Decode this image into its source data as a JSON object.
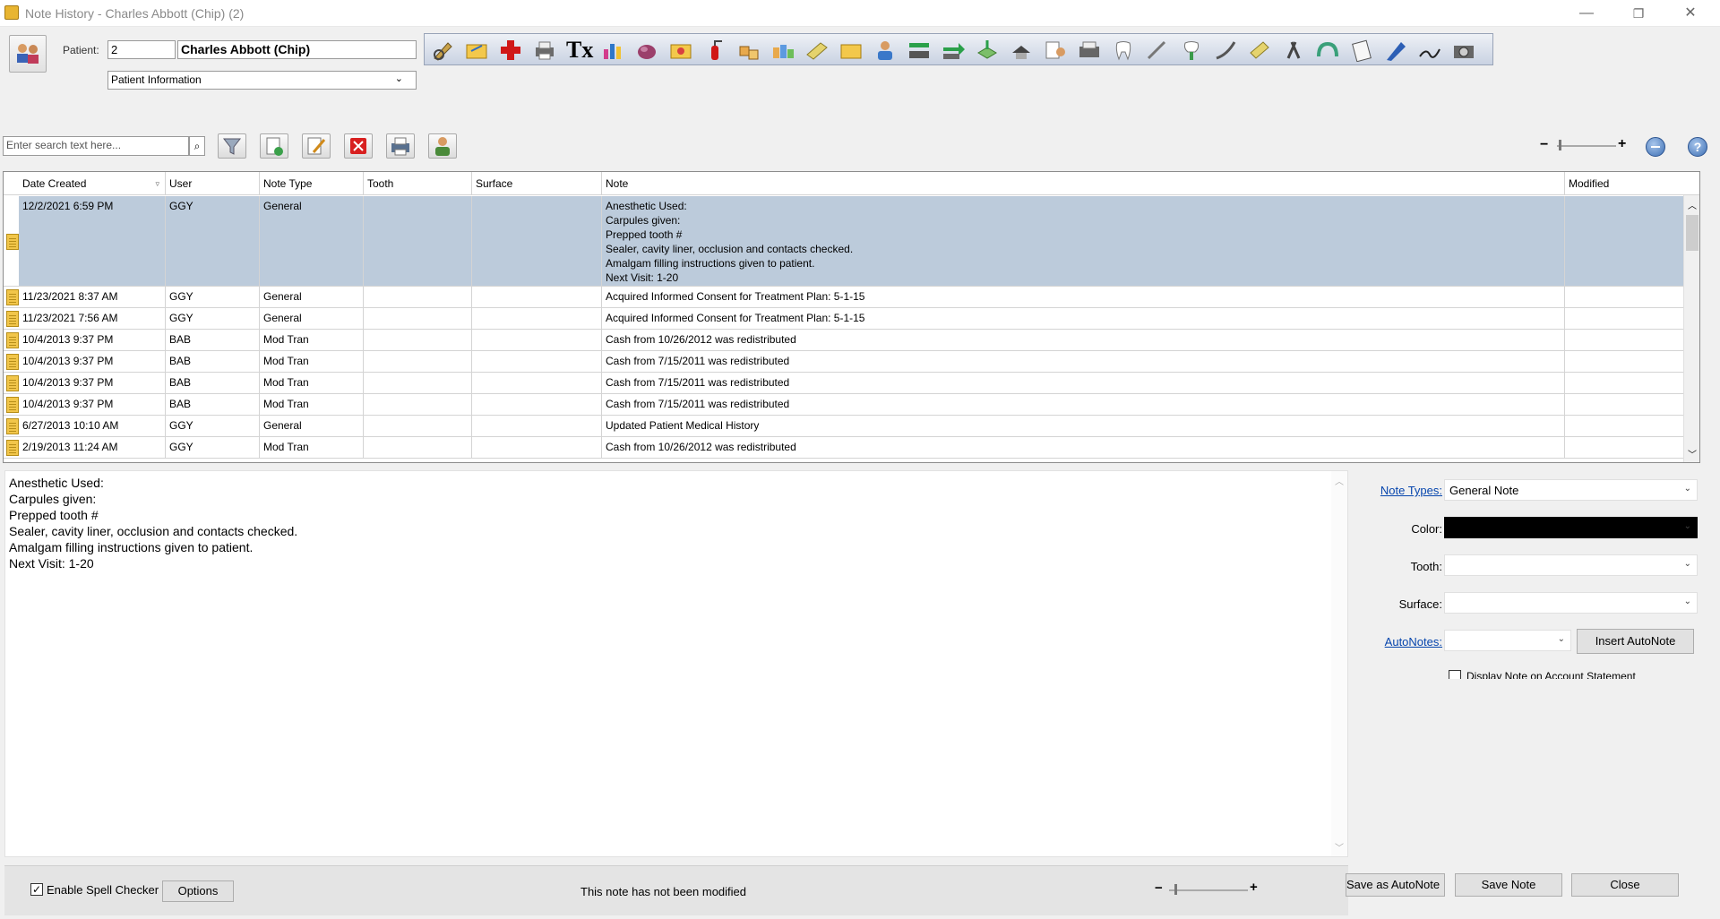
{
  "window": {
    "title": "Note History - Charles Abbott (Chip) (2)",
    "minimize": "—",
    "maximize": "❐",
    "close": "✕"
  },
  "patient": {
    "label": "Patient:",
    "id": "2",
    "name": "Charles Abbott (Chip)",
    "view_selected": "Patient Information"
  },
  "search": {
    "placeholder": "Enter search text here..."
  },
  "zoom": {
    "minus": "−",
    "plus": "+"
  },
  "grid": {
    "columns": [
      "Date Created",
      "User",
      "Note Type",
      "Tooth",
      "Surface",
      "Note",
      "Modified"
    ],
    "rows": [
      {
        "date": "12/2/2021 6:59 PM",
        "user": "GGY",
        "type": "General",
        "tooth": "",
        "surface": "",
        "note": "Anesthetic Used:\nCarpules given:\nPrepped tooth #\nSealer, cavity liner, occlusion and contacts checked.\nAmalgam filling instructions given to patient.\nNext Visit: 1-20",
        "modified": "",
        "selected": true
      },
      {
        "date": "11/23/2021 8:37 AM",
        "user": "GGY",
        "type": "General",
        "tooth": "",
        "surface": "",
        "note": "Acquired Informed Consent for Treatment Plan:  5-1-15",
        "modified": ""
      },
      {
        "date": "11/23/2021 7:56 AM",
        "user": "GGY",
        "type": "General",
        "tooth": "",
        "surface": "",
        "note": "Acquired Informed Consent for Treatment Plan:  5-1-15",
        "modified": ""
      },
      {
        "date": "10/4/2013 9:37 PM",
        "user": "BAB",
        "type": "Mod Tran",
        "tooth": "",
        "surface": "",
        "note": "Cash from 10/26/2012 was redistributed",
        "modified": ""
      },
      {
        "date": "10/4/2013 9:37 PM",
        "user": "BAB",
        "type": "Mod Tran",
        "tooth": "",
        "surface": "",
        "note": "Cash from 7/15/2011 was redistributed",
        "modified": ""
      },
      {
        "date": "10/4/2013 9:37 PM",
        "user": "BAB",
        "type": "Mod Tran",
        "tooth": "",
        "surface": "",
        "note": "Cash from 7/15/2011 was redistributed",
        "modified": ""
      },
      {
        "date": "10/4/2013 9:37 PM",
        "user": "BAB",
        "type": "Mod Tran",
        "tooth": "",
        "surface": "",
        "note": "Cash from 7/15/2011 was redistributed",
        "modified": ""
      },
      {
        "date": "6/27/2013 10:10 AM",
        "user": "GGY",
        "type": "General",
        "tooth": "",
        "surface": "",
        "note": "Updated Patient Medical History",
        "modified": ""
      },
      {
        "date": "2/19/2013 11:24 AM",
        "user": "GGY",
        "type": "Mod Tran",
        "tooth": "",
        "surface": "",
        "note": "Cash from 10/26/2012 was redistributed",
        "modified": ""
      }
    ]
  },
  "editor": {
    "text": "Anesthetic Used:\nCarpules given:\nPrepped tooth #\nSealer, cavity liner, occlusion and contacts checked.\nAmalgam filling instructions given to patient.\nNext Visit: 1-20"
  },
  "panel": {
    "note_types_label": "Note Types:",
    "note_type_value": "General Note",
    "color_label": "Color:",
    "color_value": "#000000",
    "tooth_label": "Tooth:",
    "surface_label": "Surface:",
    "autonotes_label": "AutoNotes:",
    "insert_autonote": "Insert AutoNote",
    "display_on_statement": "Display Note on Account Statement"
  },
  "bottom": {
    "spell_checker": "Enable Spell Checker",
    "options": "Options",
    "status": "This note has not been modified",
    "save_as_autonote": "Save as AutoNote",
    "save_note": "Save Note",
    "close": "Close"
  }
}
